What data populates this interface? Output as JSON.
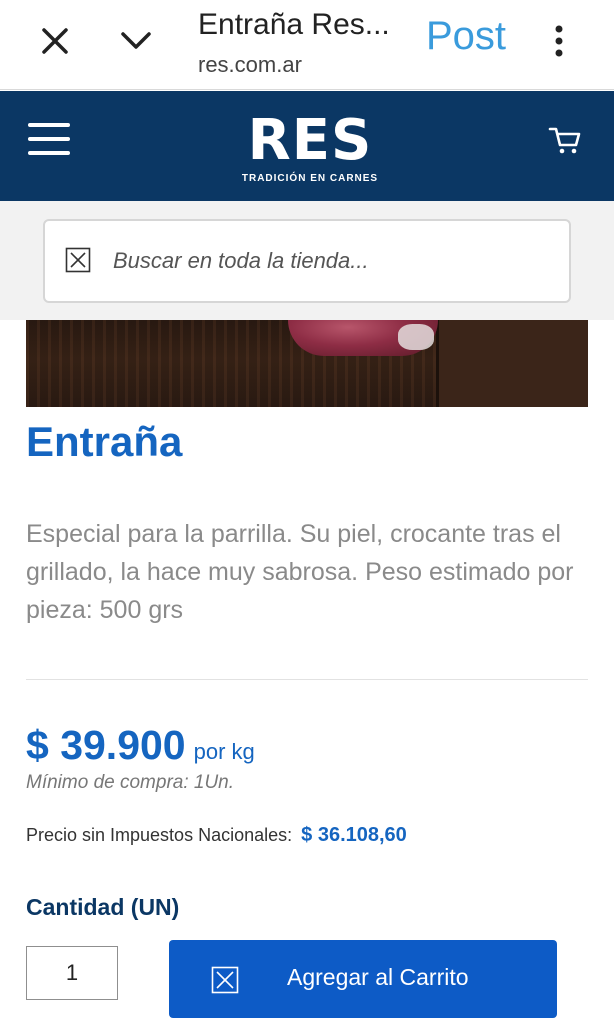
{
  "browser": {
    "title": "Entraña Res...",
    "url": "res.com.ar",
    "post_label": "Post",
    "close_icon": "close-icon",
    "collapse_icon": "chevron-down-icon",
    "more_icon": "more-vertical-icon"
  },
  "header": {
    "logo_word": "RES",
    "logo_tagline": "TRADICIÓN EN CARNES",
    "menu_icon": "hamburger-menu-icon",
    "cart_icon": "cart-icon",
    "background": "#0b3764"
  },
  "search": {
    "placeholder": "Buscar en toda la tienda...",
    "value": ""
  },
  "product": {
    "name": "Entraña",
    "description": "Especial para la parrilla. Su piel, crocante tras el grillado, la hace muy sabrosa. Peso estimado por pieza: 500 grs",
    "price": "$ 39.900",
    "price_unit": "por kg",
    "minimum_purchase": "Mínimo de compra: 1Un.",
    "tax_label": "Precio sin Impuestos Nacionales:",
    "tax_value": "$ 36.108,60",
    "quantity_label": "Cantidad (UN)",
    "quantity_value": "1",
    "add_to_cart_label": "Agregar al Carrito"
  },
  "colors": {
    "accent": "#1565c0",
    "button": "#0d5bc6",
    "post_link": "#3a9bdc"
  }
}
